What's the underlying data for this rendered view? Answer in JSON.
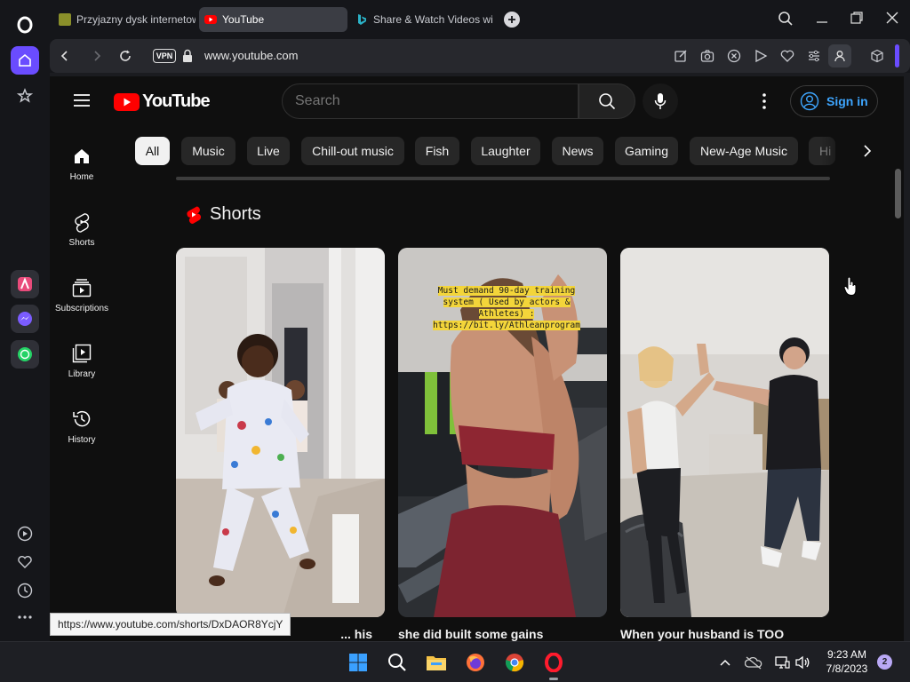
{
  "browser": {
    "tabs": [
      {
        "label": "Przyjazny dysk internetow",
        "active": false
      },
      {
        "label": "YouTube",
        "active": true
      },
      {
        "label": "Share & Watch Videos wit",
        "active": false
      }
    ],
    "url": "www.youtube.com",
    "vpn_label": "VPN",
    "status_url": "https://www.youtube.com/shorts/DxDAOR8YcjY"
  },
  "youtube": {
    "logo_text": "YouTube",
    "search_placeholder": "Search",
    "sign_in": "Sign in",
    "chips": [
      "All",
      "Music",
      "Live",
      "Chill-out music",
      "Fish",
      "Laughter",
      "News",
      "Gaming",
      "New-Age Music",
      "Hi"
    ],
    "nav": [
      {
        "label": "Home",
        "icon": "home-icon"
      },
      {
        "label": "Shorts",
        "icon": "shorts-icon"
      },
      {
        "label": "Subscriptions",
        "icon": "subscriptions-icon"
      },
      {
        "label": "Library",
        "icon": "library-icon"
      },
      {
        "label": "History",
        "icon": "history-icon"
      }
    ],
    "shorts_heading": "Shorts",
    "shorts": [
      {
        "title": "... his"
      },
      {
        "title": "she did built some gains",
        "overlay": "Must demand 90-day training system ( Used by actors & Athletes) : https://bit.ly/Athleanprogram"
      },
      {
        "title": "When your husband is TOO"
      }
    ]
  },
  "taskbar": {
    "time": "9:23 AM",
    "date": "7/8/2023",
    "notifications": "2"
  },
  "colors": {
    "youtube_red": "#ff0000",
    "accent": "#3ea6ff",
    "opera_red": "#ff1b2d",
    "opera_accent": "#6a4cff"
  }
}
